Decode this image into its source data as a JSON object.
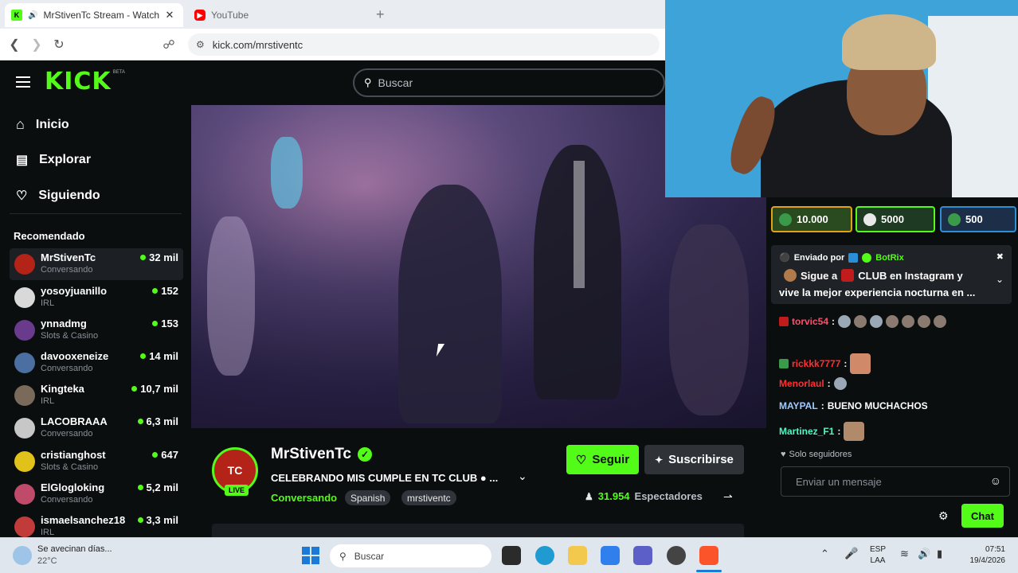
{
  "browser": {
    "tabs": [
      {
        "title": "MrStivenTc Stream - Watch Li",
        "favicon": "kick-favicon",
        "active": true
      },
      {
        "title": "YouTube",
        "favicon": "youtube-favicon",
        "active": false
      }
    ],
    "new_tab_label": "+",
    "url": "kick.com/mrstiventc"
  },
  "kick": {
    "logo": "KICK",
    "logo_badge": "BETA",
    "brand_color": "#53fc18",
    "search_placeholder": "Buscar",
    "nav": [
      {
        "label": "Inicio",
        "icon": "home-icon"
      },
      {
        "label": "Explorar",
        "icon": "compass-icon"
      },
      {
        "label": "Siguiendo",
        "icon": "heart-icon"
      }
    ],
    "recommended_title": "Recomendado",
    "recommended": [
      {
        "name": "MrStivenTc",
        "category": "Conversando",
        "viewers": "32 mil"
      },
      {
        "name": "yosoyjuanillo",
        "category": "IRL",
        "viewers": "152"
      },
      {
        "name": "ynnadmg",
        "category": "Slots & Casino",
        "viewers": "153"
      },
      {
        "name": "davooxeneize",
        "category": "Conversando",
        "viewers": "14 mil"
      },
      {
        "name": "Kingteka",
        "category": "IRL",
        "viewers": "10,7 mil"
      },
      {
        "name": "LACOBRAAA",
        "category": "Conversando",
        "viewers": "6,3 mil"
      },
      {
        "name": "cristianghost",
        "category": "Slots & Casino",
        "viewers": "647"
      },
      {
        "name": "ElGlogloking",
        "category": "Conversando",
        "viewers": "5,2 mil"
      },
      {
        "name": "ismaelsanchez18",
        "category": "IRL",
        "viewers": "3,3 mil"
      }
    ]
  },
  "stream": {
    "channel": "MrStivenTc",
    "title": "CELEBRANDO MIS CUMPLE EN TC CLUB ● ...",
    "live_label": "LIVE",
    "category": "Conversando",
    "tags": [
      "Spanish",
      "mrstiventc"
    ],
    "follow_label": "Seguir",
    "subscribe_label": "Suscribirse",
    "viewers_count": "31.954",
    "viewers_label": "Espectadores"
  },
  "chat": {
    "gifts": [
      {
        "amount": "10.000",
        "color": "#e3a116"
      },
      {
        "amount": "5000",
        "color": "#53fc18"
      },
      {
        "amount": "500",
        "color": "#2a8fd6"
      }
    ],
    "pinned_header_prefix": "Enviado por",
    "pinned_sender": "BotRix",
    "pinned_text_1": "Sigue a",
    "pinned_text_2": "CLUB en Instagram y",
    "pinned_text_3": "vive la mejor experiencia nocturna en ...",
    "messages": [
      {
        "user": "torvic54",
        "color": "#ff4d6d",
        "text": ""
      },
      {
        "user": "rickkk7777",
        "color": "#ff3030",
        "text": ""
      },
      {
        "user": "Menorlaul",
        "color": "#ff3030",
        "text": ""
      },
      {
        "user": "MAYPAL",
        "color": "#9ecbff",
        "text": "BUENO MUCHACHOS"
      },
      {
        "user": "Martinez_F1",
        "color": "#53f5c4",
        "text": ""
      }
    ],
    "followers_only": "Solo seguidores",
    "input_placeholder": "Enviar un mensaje",
    "send_label": "Chat"
  },
  "taskbar": {
    "weather_text": "Se avecinan días...",
    "temperature": "22°C",
    "search_placeholder": "Buscar",
    "language_1": "ESP",
    "language_2": "LAA",
    "time": "07:51",
    "date": "19/4/2026"
  }
}
